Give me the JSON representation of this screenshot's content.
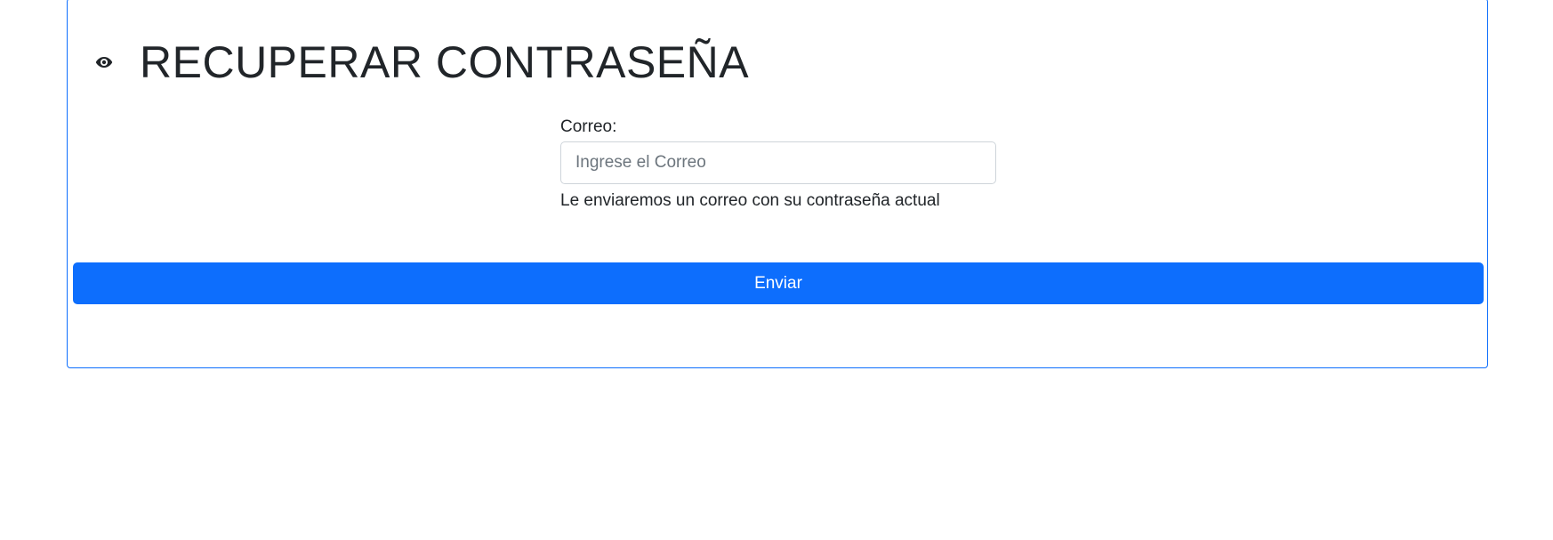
{
  "header": {
    "icon": "eye-icon",
    "title": "RECUPERAR CONTRASEÑA"
  },
  "form": {
    "email_label": "Correo:",
    "email_value": "",
    "email_placeholder": "Ingrese el Correo",
    "help_text": "Le enviaremos un correo con su contraseña actual",
    "submit_label": "Enviar"
  },
  "colors": {
    "primary": "#0d6efd",
    "text": "#212529",
    "placeholder": "#6c757d",
    "input_border": "#ced4da"
  }
}
